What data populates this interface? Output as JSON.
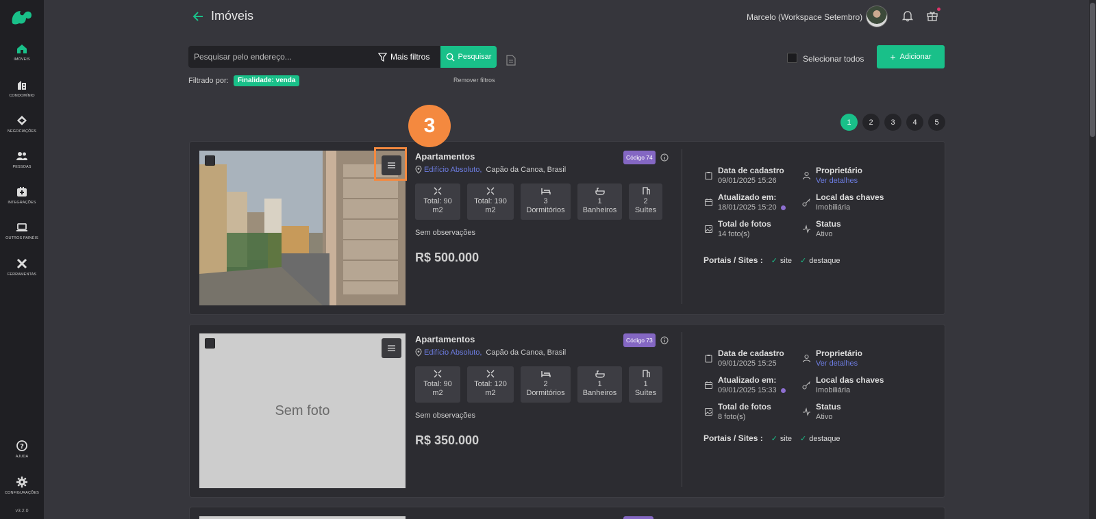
{
  "sidebar": {
    "items": [
      {
        "label": "IMÓVEIS",
        "icon": "home-icon"
      },
      {
        "label": "CONDOMÍNIO",
        "icon": "building-icon"
      },
      {
        "label": "NEGOCIAÇÕES",
        "icon": "handshake-icon"
      },
      {
        "label": "PESSOAS",
        "icon": "people-icon"
      },
      {
        "label": "INTEGRAÇÕES",
        "icon": "plug-icon"
      },
      {
        "label": "OUTROS PAINÉIS",
        "icon": "laptop-icon"
      },
      {
        "label": "FERRAMENTAS",
        "icon": "tools-icon"
      }
    ],
    "bottom": [
      {
        "label": "AJUDA",
        "icon": "help-icon"
      },
      {
        "label": "CONFIGURAÇÕES",
        "icon": "settings-icon"
      }
    ],
    "version": "v3.2.0"
  },
  "header": {
    "title": "Imóveis",
    "user": "Marcelo (Workspace Setembro)"
  },
  "search": {
    "placeholder": "Pesquisar pelo endereço...",
    "more_filters": "Mais filtros",
    "search_button": "Pesquisar",
    "filtered_by": "Filtrado por:",
    "chip": "Finalidade: venda",
    "remove_filters": "Remover filtros"
  },
  "actions": {
    "select_all": "Selecionar todos",
    "add": "Adicionar"
  },
  "pagination": [
    "1",
    "2",
    "3",
    "4",
    "5"
  ],
  "step_badge": "3",
  "listings": [
    {
      "type": "Apartamentos",
      "code": "Código 74",
      "building": "Edifício Absoluto,",
      "city": "Capão da Canoa, Brasil",
      "features": [
        {
          "line1": "Total: 90",
          "line2": "m2"
        },
        {
          "line1": "Total: 190",
          "line2": "m2"
        },
        {
          "line1": "3",
          "line2": "Dormitórios"
        },
        {
          "line1": "1",
          "line2": "Banheiros"
        },
        {
          "line1": "2",
          "line2": "Suítes"
        }
      ],
      "observations": "Sem observações",
      "price": "R$ 500.000",
      "has_photo": true,
      "meta": {
        "created_label": "Data de cadastro",
        "created": "09/01/2025 15:26",
        "owner_label": "Proprietário",
        "owner": "Ver detalhes",
        "updated_label": "Atualizado em:",
        "updated": "18/01/2025 15:20",
        "keys_label": "Local das chaves",
        "keys": "Imobiliária",
        "photos_label": "Total de fotos",
        "photos": "14 foto(s)",
        "status_label": "Status",
        "status": "Ativo"
      },
      "portals_label": "Portais / Sites :",
      "portals": [
        "site",
        "destaque"
      ]
    },
    {
      "type": "Apartamentos",
      "code": "Código 73",
      "building": "Edifício Absoluto,",
      "city": "Capão da Canoa, Brasil",
      "features": [
        {
          "line1": "Total: 90",
          "line2": "m2"
        },
        {
          "line1": "Total: 120",
          "line2": "m2"
        },
        {
          "line1": "2",
          "line2": "Dormitórios"
        },
        {
          "line1": "1",
          "line2": "Banheiros"
        },
        {
          "line1": "1",
          "line2": "Suítes"
        }
      ],
      "observations": "Sem observações",
      "price": "R$ 350.000",
      "has_photo": false,
      "no_photo_text": "Sem foto",
      "meta": {
        "created_label": "Data de cadastro",
        "created": "09/01/2025 15:25",
        "owner_label": "Proprietário",
        "owner": "Ver detalhes",
        "updated_label": "Atualizado em:",
        "updated": "09/01/2025 15:33",
        "keys_label": "Local das chaves",
        "keys": "Imobiliária",
        "photos_label": "Total de fotos",
        "photos": "8 foto(s)",
        "status_label": "Status",
        "status": "Ativo"
      },
      "portals_label": "Portais / Sites :",
      "portals": [
        "site",
        "destaque"
      ]
    }
  ],
  "colors": {
    "accent": "#19c089",
    "code_badge": "#8467c3",
    "link": "#6d7de3",
    "highlight": "#f4893f"
  }
}
